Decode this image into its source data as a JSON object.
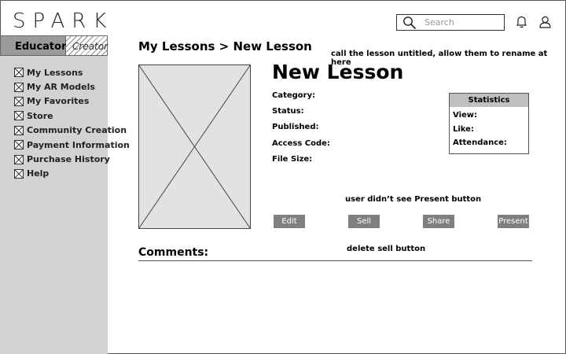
{
  "app": {
    "logo": "SPARK"
  },
  "header": {
    "search_placeholder": "Search"
  },
  "sidebar": {
    "tabs": {
      "educator": "Educator",
      "creator": "Creator"
    },
    "items": [
      {
        "label": "My Lessons"
      },
      {
        "label": "My AR Models"
      },
      {
        "label": "My Favorites"
      },
      {
        "label": "Store"
      },
      {
        "label": "Community Creation"
      },
      {
        "label": "Payment Information"
      },
      {
        "label": "Purchase History"
      },
      {
        "label": "Help"
      }
    ]
  },
  "main": {
    "breadcrumb": {
      "parent": "My Lessons",
      "sep": ">",
      "current": "New Lesson"
    },
    "title": "New Lesson",
    "fields": {
      "category": "Category:",
      "status": "Status:",
      "published": "Published:",
      "access_code": "Access Code:",
      "file_size": "File Size:"
    },
    "statistics": {
      "title": "Statistics",
      "view": "View:",
      "like": "Like:",
      "attendance": "Attendance:"
    },
    "buttons": {
      "edit": "Edit",
      "sell": "Sell",
      "share": "Share",
      "present": "Present"
    },
    "comments": "Comments:"
  },
  "notes": {
    "rename": "call the lesson untitled, allow them to rename at here",
    "present": "user didn’t see Present button",
    "sell": "delete sell button"
  }
}
